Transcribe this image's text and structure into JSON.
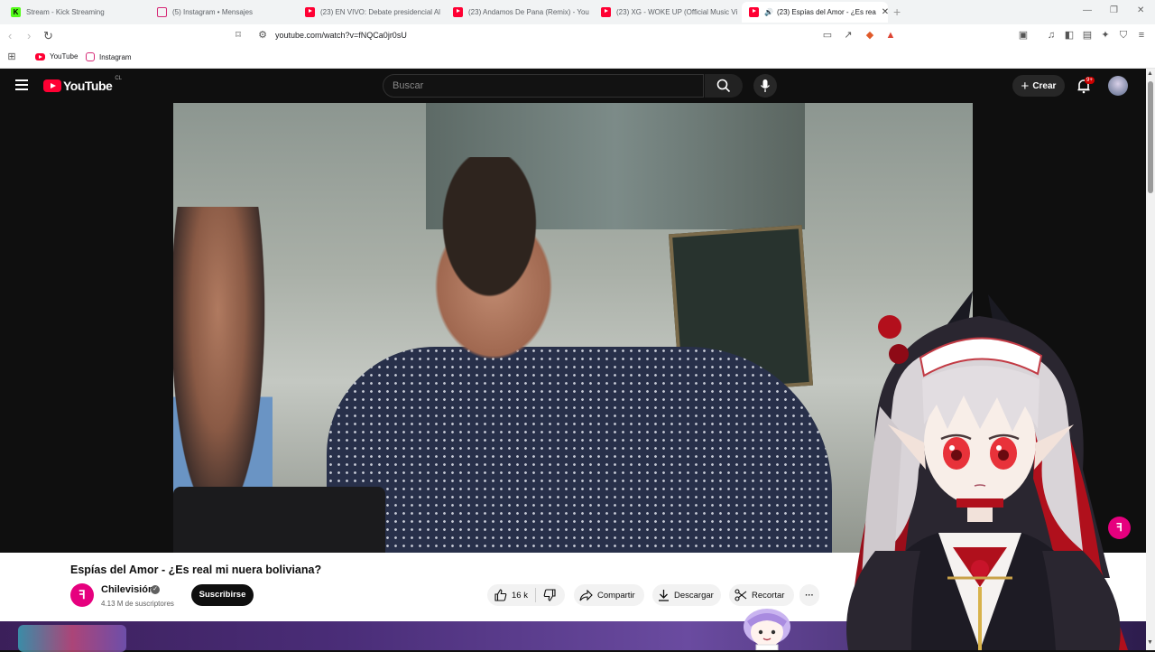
{
  "browser": {
    "tabs": [
      {
        "title": "Stream - Kick Streaming",
        "favicon": "kick-icon"
      },
      {
        "title": "(5) Instagram • Mensajes",
        "favicon": "instagram-icon"
      },
      {
        "title": "(23) EN VIVO: Debate presidencial Al",
        "favicon": "youtube-icon"
      },
      {
        "title": "(23) Andamos De Pana (Remix) - You",
        "favicon": "youtube-icon"
      },
      {
        "title": "(23) XG - WOKE UP (Official Music Vi",
        "favicon": "youtube-icon"
      },
      {
        "title": "(23) Espías del Amor - ¿Es rea",
        "favicon": "youtube-icon",
        "active": true
      }
    ],
    "url": "youtube.com/watch?v=fNQCa0jr0sU",
    "bookmarks": [
      {
        "label": "YouTube",
        "favicon": "youtube-icon"
      },
      {
        "label": "Instagram",
        "favicon": "instagram-icon"
      }
    ]
  },
  "youtube": {
    "logo_text": "YouTube",
    "country_code": "CL",
    "search_placeholder": "Buscar",
    "create_label": "Crear",
    "notification_count": "9+",
    "video": {
      "title": "Espías del Amor - ¿Es real mi nuera boliviana?",
      "channel_name": "Chilevisión",
      "channel_initial": "ꟻ",
      "subscribers": "4.13 M de suscriptores",
      "subscribe_label": "Suscribirse",
      "likes": "16 k",
      "share_label": "Compartir",
      "download_label": "Descargar",
      "clip_label": "Recortar",
      "more_label": "···"
    }
  },
  "colors": {
    "youtube_red": "#ff0033",
    "channel_pink": "#e6007e",
    "dark_bg": "#0f0f0f"
  }
}
